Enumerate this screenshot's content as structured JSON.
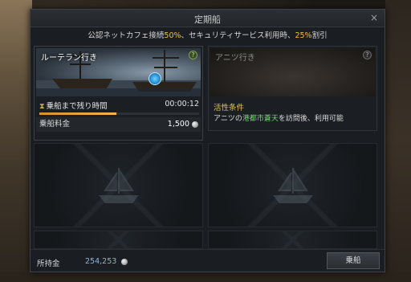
{
  "window": {
    "title": "定期船",
    "close_label": "×"
  },
  "notice": {
    "prefix": "公認ネットカフェ接続",
    "pct1": "50%",
    "middle": "、セキュリティサービス利用時、",
    "pct2": "25%",
    "suffix": "割引"
  },
  "routes": [
    {
      "name": "ルーテラン行き",
      "help": "?",
      "timer_label": "乗船まで残り時間",
      "timer_value": "00:00:12",
      "timer_progress_fraction": 0.48,
      "fare_label": "乗船料金",
      "fare_value": "1,500",
      "fare_icon": "silver-coin-icon"
    },
    {
      "name": "アニツ行き",
      "help": "?",
      "condition_title": "活性条件",
      "condition_prefix": "アニツの",
      "condition_place": "港都市蒼天",
      "condition_suffix": "を訪問後、利用可能"
    }
  ],
  "footer": {
    "money_label": "所持金",
    "money_value": "254,253",
    "money_icon": "silver-coin-icon",
    "board_button": "乗船"
  },
  "colors": {
    "highlight": "#e8c344",
    "progress": "#f2b640",
    "place": "#7ed07e",
    "money": "#8fb2e0"
  }
}
